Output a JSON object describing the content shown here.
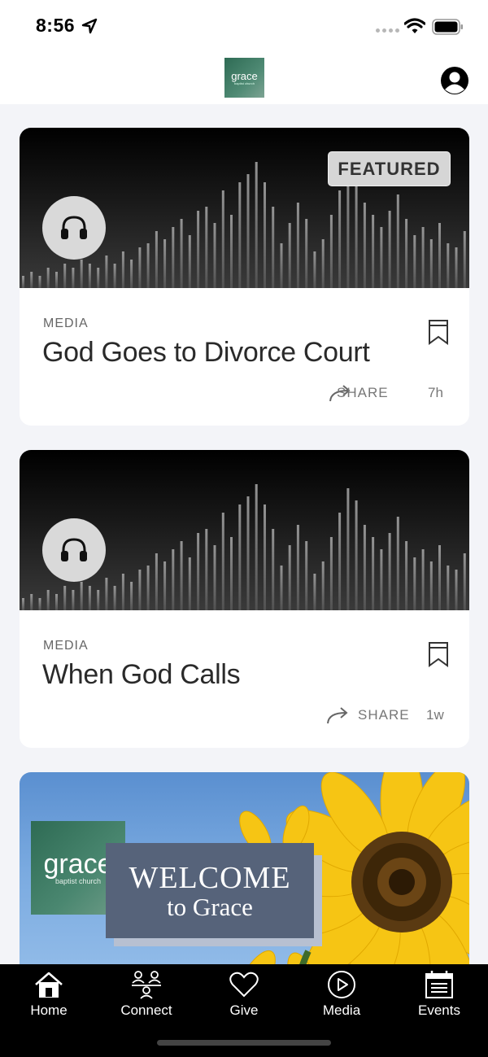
{
  "status_bar": {
    "time": "8:56"
  },
  "header": {
    "logo_main": "grace",
    "logo_sub": "baptist church"
  },
  "feed": {
    "items": [
      {
        "featured_label": "FEATURED",
        "category": "MEDIA",
        "title": "God Goes to Divorce Court",
        "share_label": "SHARE",
        "age": "7h"
      },
      {
        "category": "MEDIA",
        "title": "When God Calls",
        "share_label": "SHARE",
        "age": "1w"
      }
    ],
    "welcome_banner": {
      "logo_main": "grace",
      "logo_sub": "baptist church",
      "line1": "WELCOME",
      "line2": "to Grace"
    }
  },
  "tabbar": {
    "tabs": [
      {
        "label": "Home",
        "icon": "home-icon"
      },
      {
        "label": "Connect",
        "icon": "connect-icon"
      },
      {
        "label": "Give",
        "icon": "heart-icon"
      },
      {
        "label": "Media",
        "icon": "play-icon"
      },
      {
        "label": "Events",
        "icon": "calendar-icon"
      }
    ]
  },
  "colors": {
    "brand_green": "#2e6b54",
    "background": "#f3f4f8",
    "tabbar": "#000000",
    "welcome_box": "#56637a"
  }
}
